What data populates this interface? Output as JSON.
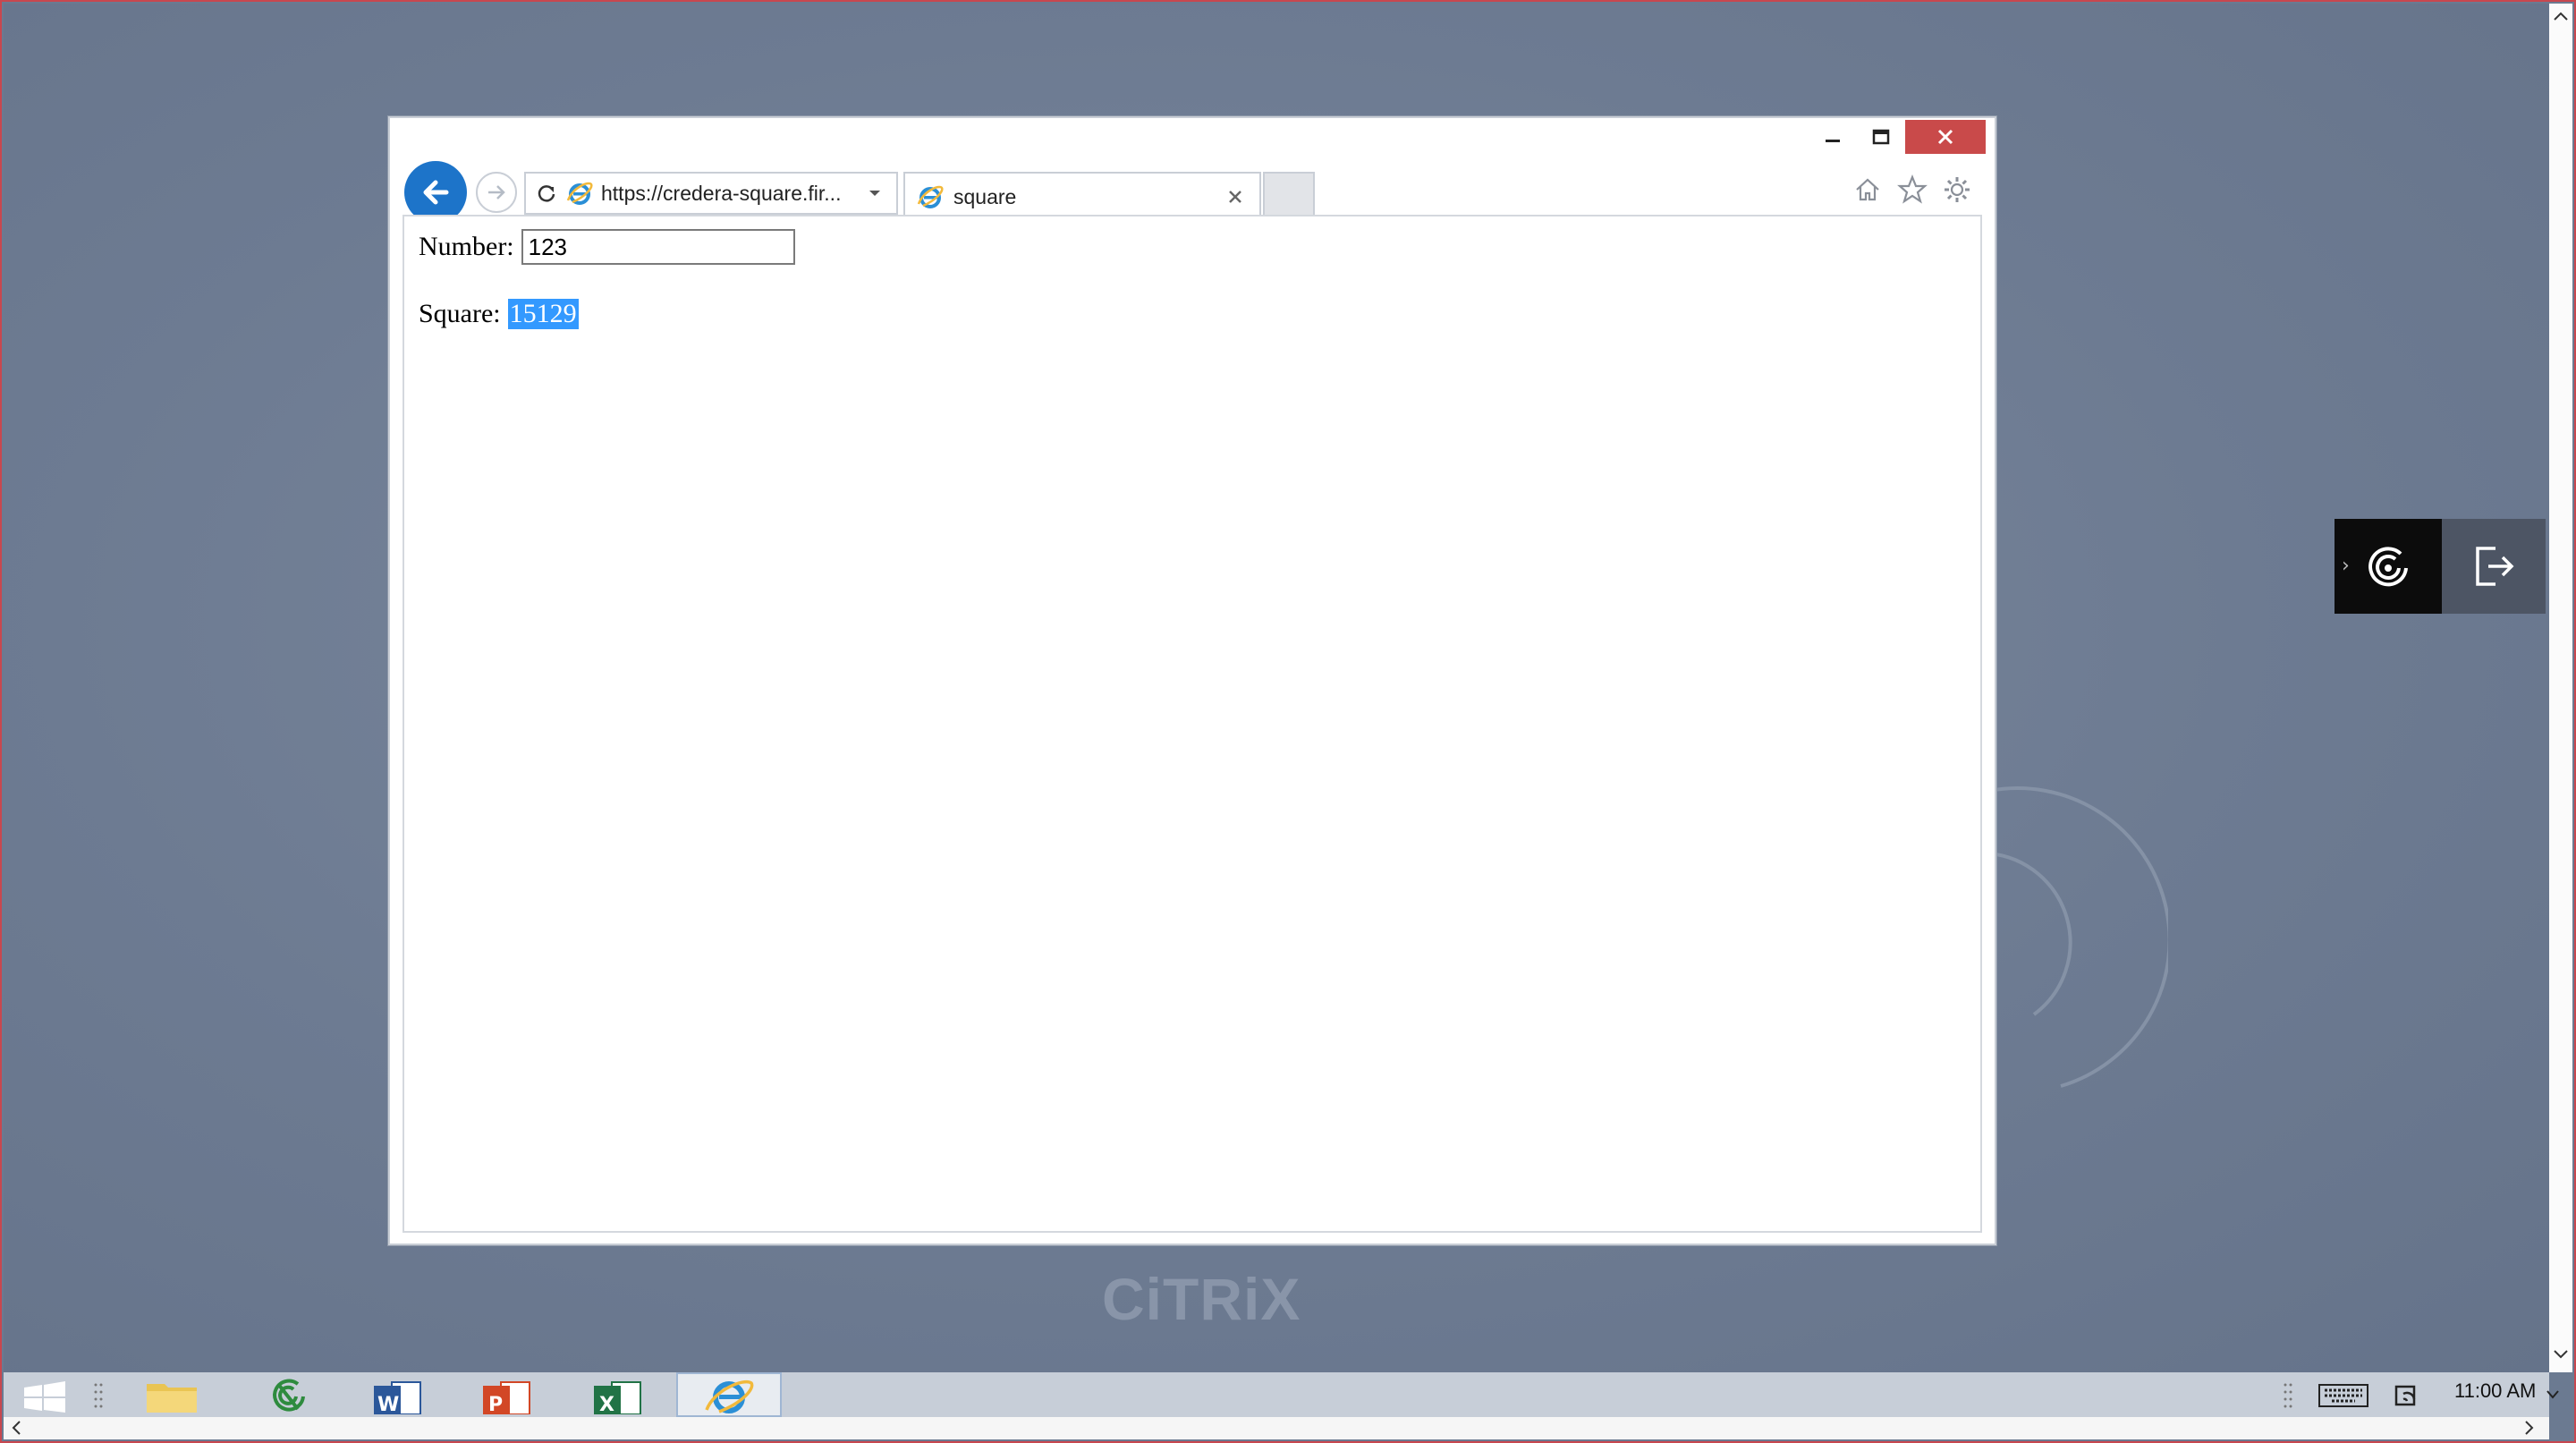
{
  "browser": {
    "address_url": "https://credera-square.fir...",
    "tab_title": "square"
  },
  "page": {
    "number_label": "Number:",
    "number_value": "123",
    "square_label": "Square:",
    "square_value": "15129"
  },
  "desktop": {
    "watermark": "CiTRiX"
  },
  "taskbar": {
    "clock": "11:00 AM",
    "apps": [
      "start-icon",
      "file-explorer-icon",
      "citrix-receiver-icon",
      "word-icon",
      "powerpoint-icon",
      "excel-icon",
      "internet-explorer-icon"
    ]
  },
  "colors": {
    "desktop_bg": "#6b7a91",
    "accent_blue": "#1d74c9",
    "close_red": "#c94a4a",
    "selection": "#3399ff",
    "frame_border": "#c8474f"
  }
}
